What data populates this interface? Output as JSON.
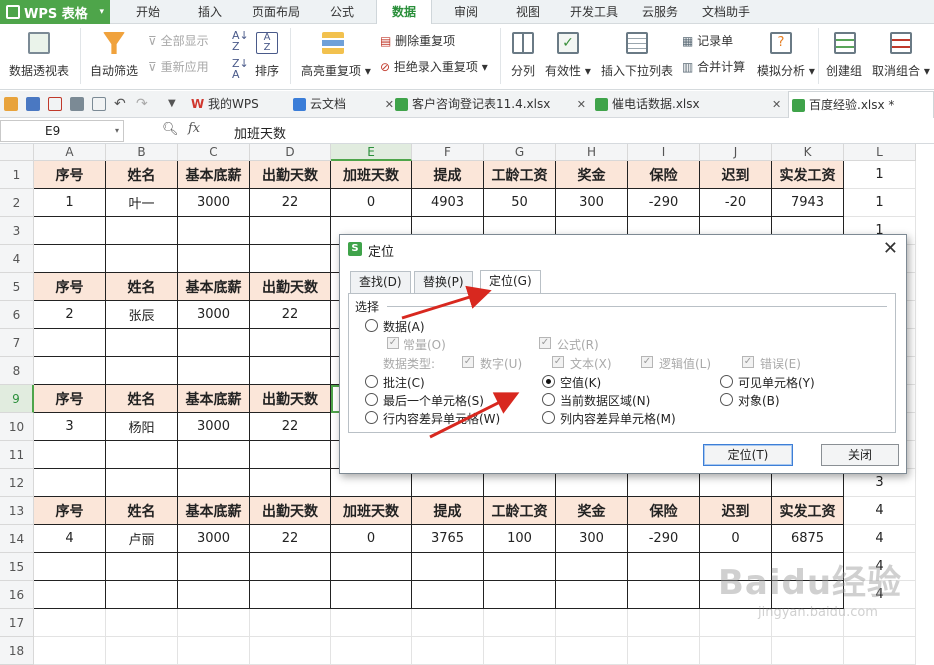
{
  "app": {
    "name": "WPS 表格"
  },
  "menu": {
    "tabs": [
      "开始",
      "插入",
      "页面布局",
      "公式",
      "数据",
      "审阅",
      "视图",
      "开发工具",
      "云服务",
      "文档助手"
    ],
    "active": "数据"
  },
  "toolbar": {
    "pivot": "数据透视表",
    "autofilter": "自动筛选",
    "show_all": "全部显示",
    "reapply": "重新应用",
    "sort": "排序",
    "highlight_dup": "高亮重复项",
    "remove_dup": "删除重复项",
    "reject_dup": "拒绝录入重复项",
    "split": "分列",
    "validity": "有效性",
    "insert_dropdown": "插入下拉列表",
    "record_form": "记录单",
    "merge_calc": "合并计算",
    "simulate": "模拟分析",
    "create_group": "创建组",
    "ungroup": "取消组合"
  },
  "doc_tabs": [
    "我的WPS",
    "云文档",
    "客户咨询登记表11.4.xlsx",
    "催电话数据.xlsx",
    "百度经验.xlsx *"
  ],
  "formula_bar": {
    "cell": "E9",
    "fx": "fx",
    "value": "加班天数"
  },
  "columns": [
    "A",
    "B",
    "C",
    "D",
    "E",
    "F",
    "G",
    "H",
    "I",
    "J",
    "K",
    "L"
  ],
  "rows": [
    "1",
    "2",
    "3",
    "4",
    "5",
    "6",
    "7",
    "8",
    "9",
    "10",
    "11",
    "12",
    "13",
    "14",
    "15",
    "16",
    "17",
    "18"
  ],
  "headers": [
    "序号",
    "姓名",
    "基本底薪",
    "出勤天数",
    "加班天数",
    "提成",
    "工龄工资",
    "奖金",
    "保险",
    "迟到",
    "实发工资"
  ],
  "records": [
    [
      "1",
      "叶一",
      "3000",
      "22",
      "0",
      "4903",
      "50",
      "300",
      "-290",
      "-20",
      "7943"
    ],
    [
      "2",
      "张辰",
      "3000",
      "22",
      "",
      "",
      "",
      "",
      "",
      "",
      ""
    ],
    [
      "3",
      "杨阳",
      "3000",
      "22",
      "",
      "",
      "",
      "",
      "",
      "",
      ""
    ],
    [
      "4",
      "卢丽",
      "3000",
      "22",
      "0",
      "3765",
      "100",
      "300",
      "-290",
      "0",
      "6875"
    ]
  ],
  "col_l": {
    "1": "1",
    "2": "1",
    "3": "1",
    "12": "3",
    "13": "4",
    "14": "4",
    "15": "4",
    "16": "4"
  },
  "dialog": {
    "title": "定位",
    "tabs": [
      "查找(D)",
      "替换(P)",
      "定位(G)"
    ],
    "group": "选择",
    "data": "数据(A)",
    "constant": "常量(O)",
    "formula": "公式(R)",
    "data_type": "数据类型:",
    "number": "数字(U)",
    "text": "文本(X)",
    "logical": "逻辑值(L)",
    "error": "错误(E)",
    "comment": "批注(C)",
    "blank": "空值(K)",
    "visible": "可见单元格(Y)",
    "last_cell": "最后一个单元格(S)",
    "current_region": "当前数据区域(N)",
    "object": "对象(B)",
    "row_diff": "行内容差异单元格(W)",
    "col_diff": "列内容差异单元格(M)",
    "locate_btn": "定位(T)",
    "close_btn": "关闭"
  },
  "watermark": {
    "main": "Baidu经验",
    "sub": "jingyan.baidu.com"
  }
}
